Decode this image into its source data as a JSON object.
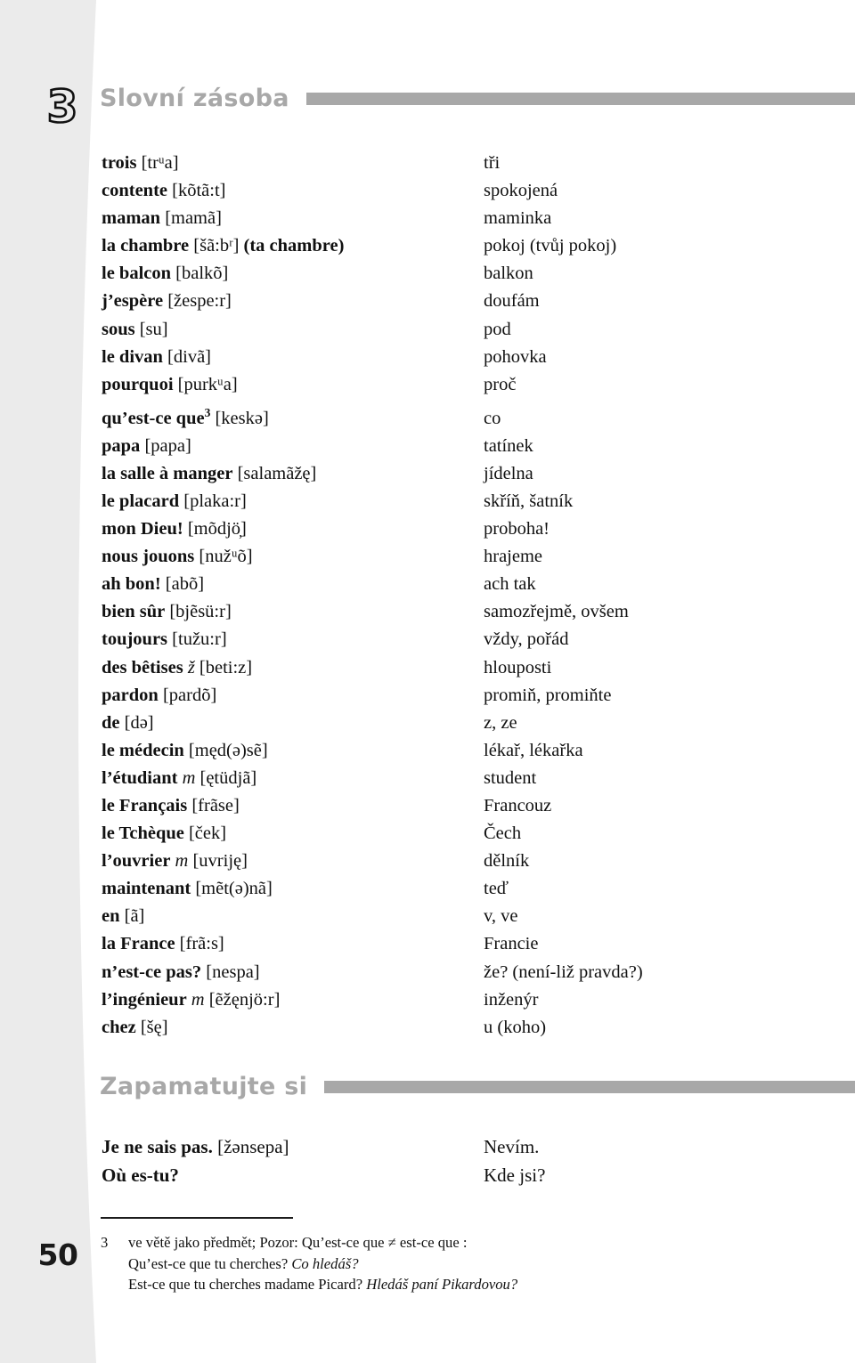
{
  "page": {
    "chapter_number": "3",
    "page_number": "50"
  },
  "sections": {
    "vocabulary_heading": "Slovní zásoba",
    "remember_heading": "Zapamatujte si"
  },
  "vocabulary": [
    {
      "term": "trois",
      "phon": "[trᵘa]",
      "cs": "tři"
    },
    {
      "term": "contente",
      "phon": "[kõtã:t]",
      "cs": "spokojená"
    },
    {
      "term": "maman",
      "phon": "[mamã]",
      "cs": "maminka"
    },
    {
      "term": "la chambre",
      "phon": "[šã:bʳ]",
      "extra": "(ta chambre)",
      "cs": "pokoj (tvůj pokoj)"
    },
    {
      "term": "le balcon",
      "phon": "[balkõ]",
      "cs": "balkon"
    },
    {
      "term": "j’espère",
      "phon": "[žespe:r]",
      "cs": "doufám"
    },
    {
      "term": "sous",
      "phon": "[su]",
      "cs": "pod"
    },
    {
      "term": "le divan",
      "phon": "[divã]",
      "cs": "pohovka"
    },
    {
      "term": "pourquoi",
      "phon": "[purkᵘa]",
      "cs": "proč"
    },
    {
      "term": "qu’est-ce que",
      "sup": "3",
      "phon": "[keskə]",
      "cs": "co"
    },
    {
      "term": "papa",
      "phon": "[papa]",
      "cs": "tatínek"
    },
    {
      "term": "la salle à manger",
      "phon": "[salamãžę]",
      "cs": "jídelna"
    },
    {
      "term": "le placard",
      "phon": "[plaka:r]",
      "cs": "skříň, šatník"
    },
    {
      "term": "mon Dieu!",
      "phon": "[mõdjö̦]",
      "cs": "proboha!"
    },
    {
      "term": "nous jouons",
      "phon": "[nužᵘõ]",
      "cs": "hrajeme"
    },
    {
      "term": "ah bon!",
      "phon": "[abõ]",
      "cs": "ach tak"
    },
    {
      "term": "bien sûr",
      "phon": "[bjẽsü:r]",
      "cs": "samozřejmě, ovšem"
    },
    {
      "term": "toujours",
      "phon": "[tužu:r]",
      "cs": "vždy, pořád"
    },
    {
      "term": "des bêtises",
      "gender": "ž",
      "phon": "[beti:z]",
      "cs": "hlouposti"
    },
    {
      "term": "pardon",
      "phon": "[pardõ]",
      "cs": "promiň, promiňte"
    },
    {
      "term": "de",
      "phon": "[də]",
      "cs": "z, ze"
    },
    {
      "term": "le médecin",
      "phon": "[męd(ə)sẽ]",
      "cs": "lékař, lékařka"
    },
    {
      "term": "l’étudiant",
      "gender": "m",
      "phon": "[ętüdjã]",
      "cs": "student"
    },
    {
      "term": "le Français",
      "phon": "[frãse]",
      "cs": "Francouz"
    },
    {
      "term": "le Tchèque",
      "phon": "[ček]",
      "cs": "Čech"
    },
    {
      "term": "l’ouvrier",
      "gender": "m",
      "phon": "[uvriję]",
      "cs": "dělník"
    },
    {
      "term": "maintenant",
      "phon": "[mẽt(ə)nã]",
      "cs": "teď"
    },
    {
      "term": "en",
      "phon": "[ã]",
      "cs": "v, ve"
    },
    {
      "term": "la France",
      "phon": "[frã:s]",
      "cs": "Francie"
    },
    {
      "term": "n’est-ce pas?",
      "phon": "[nespa]",
      "cs": "že? (není-liž pravda?)"
    },
    {
      "term": "l’ingénieur",
      "gender": "m",
      "phon": "[ẽžęnjö:r]",
      "cs": "inženýr"
    },
    {
      "term": "chez",
      "phon": "[šę]",
      "cs": "u (koho)"
    }
  ],
  "phrases": [
    {
      "term": "Je ne sais pas.",
      "phon": "[žənsepa]",
      "cs": "Nevím."
    },
    {
      "term": "Où es-tu?",
      "phon": "",
      "cs": "Kde jsi?"
    }
  ],
  "footnote": {
    "marker": "3",
    "line1": "ve větě jako předmět; Pozor: Qu’est-ce que ≠ est-ce que :",
    "line2_plain": "Qu’est-ce que tu cherches? ",
    "line2_italic": "Co hledáš?",
    "line3_plain": "Est-ce que tu cherches madame Picard? ",
    "line3_italic": "Hledáš paní Pikardovou?"
  },
  "colors": {
    "margin_band": "#ebebeb",
    "heading_grey": "#a8a8a8",
    "text": "#111111"
  }
}
